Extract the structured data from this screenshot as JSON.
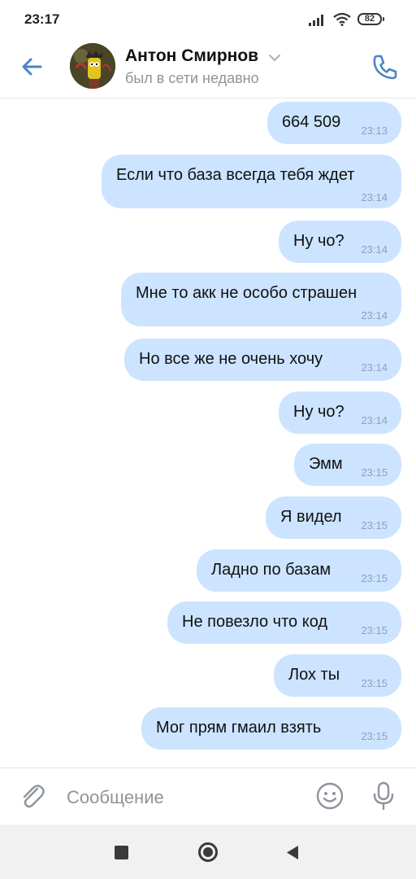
{
  "status_bar": {
    "time": "23:17",
    "battery": "82",
    "icons": [
      "signal-icon",
      "wifi-icon",
      "battery-icon"
    ]
  },
  "header": {
    "name": "Антон Смирнов",
    "status": "был в сети недавно",
    "icons": [
      "back-arrow-icon",
      "avatar",
      "chevron-down-icon",
      "phone-icon"
    ]
  },
  "messages": [
    {
      "text": "664 509",
      "time": "23:13"
    },
    {
      "text": "Если что база всегда тебя ждет",
      "time": "23:14"
    },
    {
      "text": "Ну чо?",
      "time": "23:14"
    },
    {
      "text": "Мне то акк не особо страшен",
      "time": "23:14"
    },
    {
      "text": "Но все же не очень хочу",
      "time": "23:14"
    },
    {
      "text": "Ну чо?",
      "time": "23:14"
    },
    {
      "text": "Эмм",
      "time": "23:15"
    },
    {
      "text": "Я видел",
      "time": "23:15"
    },
    {
      "text": "Ладно по базам",
      "time": "23:15"
    },
    {
      "text": "Не повезло что код",
      "time": "23:15"
    },
    {
      "text": "Лох ты",
      "time": "23:15"
    },
    {
      "text": "Мог прям гмаил взять",
      "time": "23:15"
    }
  ],
  "composer": {
    "placeholder": "Сообщение",
    "value": "",
    "icons": [
      "paperclip-icon",
      "emoji-icon",
      "microphone-icon"
    ]
  },
  "nav": {
    "icons": [
      "recents-square-icon",
      "home-circle-icon",
      "back-triangle-icon"
    ]
  },
  "colors": {
    "accent": "#4a86c5",
    "bubble": "#cce4ff",
    "timestamp": "#8aa2bd",
    "secondary_text": "#8e949b"
  }
}
